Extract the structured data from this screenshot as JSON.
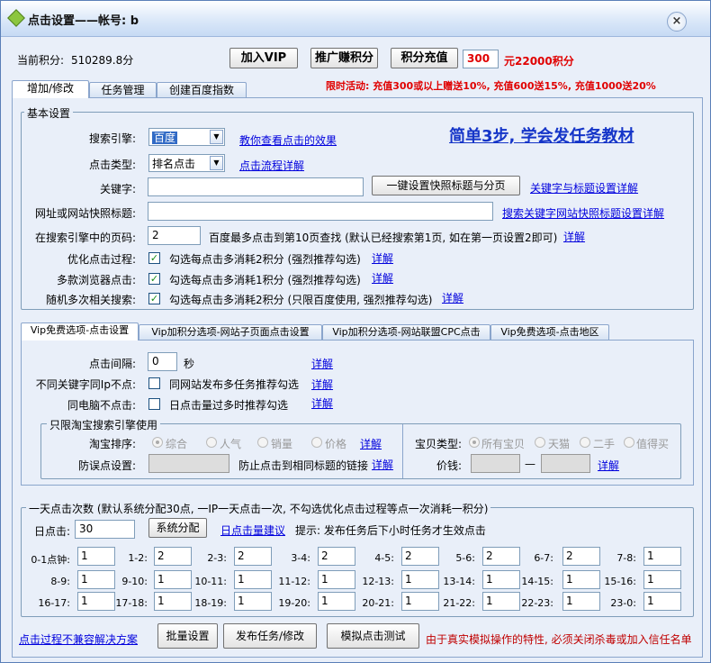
{
  "title": "点击设置——帐号: b",
  "close_glyph": "×",
  "header": {
    "points_label": "当前积分:",
    "points_value": "510289.8分",
    "btn_vip": "加入VIP",
    "btn_promote": "推广赚积分",
    "btn_recharge": "积分充值",
    "recharge_amount": "300",
    "recharge_offer": "元22000积分",
    "promo": "限时活动: 充值300或以上赠送10%, 充值600送15%, 充值1000送20%"
  },
  "main_tabs": [
    "增加/修改",
    "任务管理",
    "创建百度指数"
  ],
  "basic": {
    "group_title": "基本设置",
    "engine_label": "搜索引擎:",
    "engine_value": "百度",
    "engine_link": "教你查看点击的效果",
    "click_type_label": "点击类型:",
    "click_type_value": "排名点击",
    "click_type_link": "点击流程详解",
    "tutorial_link": "简单3步, 学会发任务教材",
    "keyword_label": "关键字:",
    "keyword_value": "",
    "one_key_btn": "一键设置快照标题与分页",
    "keyword_link": "关键字与标题设置详解",
    "url_label": "网址或网站快照标题:",
    "url_value": "",
    "url_link": "搜索关键字网站快照标题设置详解",
    "page_label": "在搜索引擎中的页码:",
    "page_value": "2",
    "page_hint": "百度最多点击到第10页查找 (默认已经搜索第1页, 如在第一页设置2即可)",
    "detail": "详解",
    "optimize_label": "优化点击过程:",
    "optimize_text": "勾选每点击多消耗2积分 (强烈推荐勾选)",
    "multi_browser_label": "多款浏览器点击:",
    "multi_browser_text": "勾选每点击多消耗1积分 (强烈推荐勾选)",
    "random_label": "随机多次相关搜索:",
    "random_text": "勾选每点击多消耗2积分 (只限百度使用, 强烈推荐勾选)",
    "check_glyph": "✓"
  },
  "vip_tabs": [
    "Vip免费选项-点击设置",
    "Vip加积分选项-网站子页面点击设置",
    "Vip加积分选项-网站联盟CPC点击",
    "Vip免费选项-点击地区"
  ],
  "vip": {
    "interval_label": "点击间隔:",
    "interval_value": "0",
    "interval_unit": "秒",
    "diff_ip_label": "不同关键字同Ip不点:",
    "diff_ip_text": "同网站发布多任务推荐勾选",
    "same_pc_label": "同电脑不点击:",
    "same_pc_text": "日点击量过多时推荐勾选",
    "taobao_title": "只限淘宝搜索引擎使用",
    "sort_label": "淘宝排序:",
    "sort_options": [
      "综合",
      "人气",
      "销量",
      "价格"
    ],
    "mistake_label": "防误点设置:",
    "mistake_text": "防止点击到相同标题的链接",
    "item_type_label": "宝贝类型:",
    "item_type_options": [
      "所有宝贝",
      "天猫",
      "二手",
      "值得买"
    ],
    "price_label": "价钱:",
    "price_dash": "—"
  },
  "daily": {
    "group_title": "一天点击次数 (默认系统分配30点, 一IP一天点击一次, 不勾选优化点击过程等点一次消耗一积分)",
    "daily_label": "日点击:",
    "daily_value": "30",
    "sys_btn": "系统分配",
    "suggest_link": "日点击量建议",
    "tip": "提示: 发布任务后下小时任务才生效点击",
    "hours": [
      {
        "label": "0-1点钟:",
        "value": "1"
      },
      {
        "label": "1-2:",
        "value": "2"
      },
      {
        "label": "2-3:",
        "value": "2"
      },
      {
        "label": "3-4:",
        "value": "2"
      },
      {
        "label": "4-5:",
        "value": "2"
      },
      {
        "label": "5-6:",
        "value": "2"
      },
      {
        "label": "6-7:",
        "value": "2"
      },
      {
        "label": "7-8:",
        "value": "1"
      },
      {
        "label": "8-9:",
        "value": "1"
      },
      {
        "label": "9-10:",
        "value": "1"
      },
      {
        "label": "10-11:",
        "value": "1"
      },
      {
        "label": "11-12:",
        "value": "1"
      },
      {
        "label": "12-13:",
        "value": "1"
      },
      {
        "label": "13-14:",
        "value": "1"
      },
      {
        "label": "14-15:",
        "value": "1"
      },
      {
        "label": "15-16:",
        "value": "1"
      },
      {
        "label": "16-17:",
        "value": "1"
      },
      {
        "label": "17-18:",
        "value": "1"
      },
      {
        "label": "18-19:",
        "value": "1"
      },
      {
        "label": "19-20:",
        "value": "1"
      },
      {
        "label": "20-21:",
        "value": "1"
      },
      {
        "label": "21-22:",
        "value": "1"
      },
      {
        "label": "22-23:",
        "value": "1"
      },
      {
        "label": "23-0:",
        "value": "1"
      }
    ]
  },
  "footer": {
    "compat_link": "点击过程不兼容解决方案",
    "batch_btn": "批量设置",
    "publish_btn": "发布任务/修改",
    "simulate_btn": "模拟点击测试",
    "warning": "由于真实模拟操作的特性, 必须关闭杀毒或加入信任名单"
  }
}
